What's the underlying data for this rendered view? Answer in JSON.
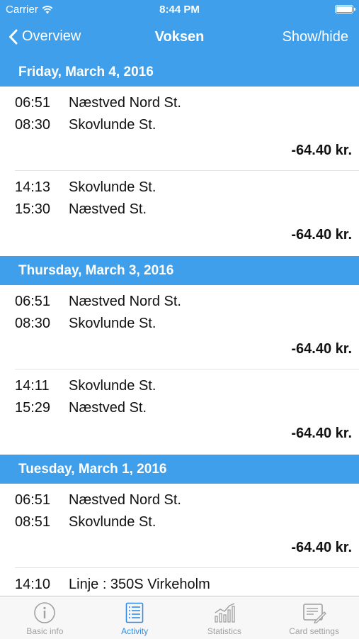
{
  "status_bar": {
    "carrier": "Carrier",
    "time": "8:44 PM"
  },
  "nav": {
    "back_label": "Overview",
    "title": "Voksen",
    "right_label": "Show/hide"
  },
  "days": [
    {
      "header": "Friday, March 4, 2016",
      "trips": [
        {
          "time1": "06:51",
          "place1": "Næstved Nord St.",
          "time2": "08:30",
          "place2": "Skovlunde St.",
          "amount": "-64.40 kr."
        },
        {
          "time1": "14:13",
          "place1": "Skovlunde St.",
          "time2": "15:30",
          "place2": "Næstved St.",
          "amount": "-64.40 kr."
        }
      ]
    },
    {
      "header": "Thursday, March 3, 2016",
      "trips": [
        {
          "time1": "06:51",
          "place1": "Næstved Nord St.",
          "time2": "08:30",
          "place2": "Skovlunde St.",
          "amount": "-64.40 kr."
        },
        {
          "time1": "14:11",
          "place1": "Skovlunde St.",
          "time2": "15:29",
          "place2": "Næstved St.",
          "amount": "-64.40 kr."
        }
      ]
    },
    {
      "header": "Tuesday, March 1, 2016",
      "trips": [
        {
          "time1": "06:51",
          "place1": "Næstved Nord St.",
          "time2": "08:51",
          "place2": "Skovlunde St.",
          "amount": "-64.40 kr."
        },
        {
          "time1": "14:10",
          "place1": "Linje : 350S Virkeholm"
        }
      ]
    }
  ],
  "tabbar": {
    "active_color": "#2f8de6",
    "inactive_color": "#a0a0a0",
    "tabs": [
      {
        "label": "Basic info",
        "icon": "info-icon"
      },
      {
        "label": "Activity",
        "icon": "list-icon",
        "active": true
      },
      {
        "label": "Statistics",
        "icon": "chart-icon"
      },
      {
        "label": "Card settings",
        "icon": "card-edit-icon"
      }
    ]
  },
  "colors": {
    "accent": "#3f9fea",
    "text": "#111111",
    "separator": "#e2e2e2"
  }
}
